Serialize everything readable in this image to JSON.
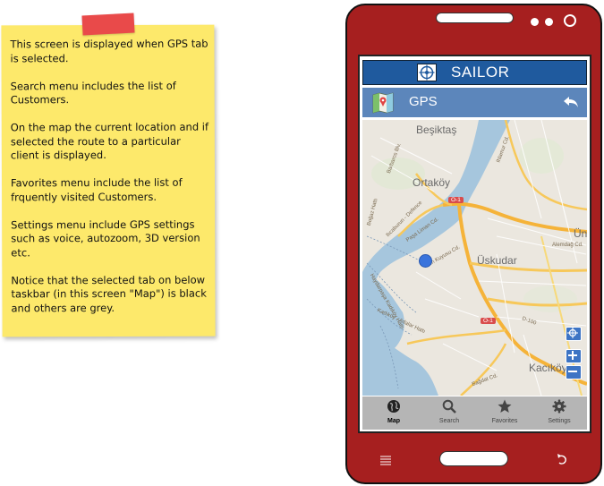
{
  "note": {
    "paragraphs": [
      "This screen is displayed when GPS tab is selected.",
      "Search menu includes the list of Customers.",
      "On the map the current location and if selected the route to a particular client is displayed.",
      "Favorites menu include the list of frquently visited Customers.",
      "Settings menu include GPS settings such as voice, autozoom, 3D version etc.",
      "Notice that the selected tab on below taskbar (in this screen \"Map\") is black and others are grey."
    ]
  },
  "app": {
    "title": "SAILOR",
    "section_title": "GPS",
    "logo_icon": "compass-icon"
  },
  "map": {
    "places": [
      "Beşiktaş",
      "Ortaköy",
      "Üskudar",
      "Ün",
      "Kacıköy"
    ],
    "street_labels": [
      "Barbaros Blv.",
      "Boğaz Hattı",
      "Ilıcaburun - Defence",
      "Paşa Liman Cd.",
      "Nuh Kuyusu Cd.",
      "Haydarpaşa Kadıköy Hattı",
      "Kadıköy - Adalar Hattı",
      "Alemdağ Cd.",
      "Ihlamur Cd.",
      "D-100",
      "Bağdat Cd."
    ],
    "road_badges": [
      "O-1",
      "O-1"
    ]
  },
  "tabs": [
    {
      "label": "Map",
      "icon": "globe-icon",
      "active": true
    },
    {
      "label": "Search",
      "icon": "search-icon",
      "active": false
    },
    {
      "label": "Favorites",
      "icon": "star-icon",
      "active": false
    },
    {
      "label": "Settings",
      "icon": "gear-icon",
      "active": false
    }
  ],
  "colors": {
    "phone_body": "#a61f1f",
    "title_bar": "#1f5a9e",
    "gps_bar": "#5c86bb",
    "note": "#fde96b",
    "tape": "#e94a4a",
    "location_dot": "#3a74dc"
  }
}
